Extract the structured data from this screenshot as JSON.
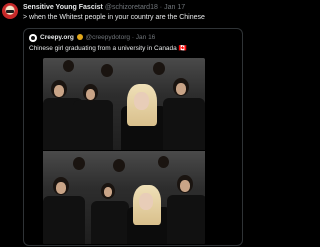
{
  "tweet": {
    "display_name": "Sensitive Young Fascist",
    "handle_line": "@schizoretard18 · Jan 17",
    "text": "> when the Whitest people in your country are the Chinese",
    "avatar": "avatar-icon"
  },
  "quoted_tweet": {
    "display_name": "Creepy.org",
    "handle_line": "@creepydotorg · Jan 16",
    "text": "Chinese girl graduating from a university in Canada 🇨🇦",
    "verified_badge": "gold-verified-badge-icon",
    "avatar": "creepy-org-avatar-icon",
    "media": "graduation-ceremony-photo"
  },
  "colors": {
    "background": "#000000",
    "primary_text": "#e7e9ea",
    "secondary_text": "#71767b",
    "border": "#2f3336",
    "badge": "#e2a81b"
  }
}
